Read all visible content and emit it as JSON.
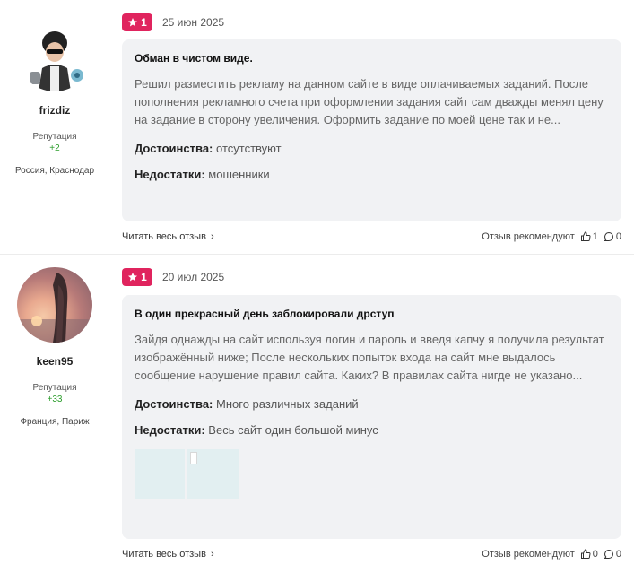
{
  "reviews": [
    {
      "author": {
        "name": "frizdiz",
        "reputation_label": "Репутация",
        "reputation_value": "+2",
        "location": "Россия, Краснодар"
      },
      "rating": "1",
      "date": "25 июн 2025",
      "title": "Обман в чистом виде.",
      "text": "Решил разместить рекламу на данном сайте в виде оплачиваемых заданий. После пополнения рекламного счета при оформлении задания сайт сам дважды менял цену на задание в сторону увеличения. Оформить задание по моей цене так и не...",
      "pros_label": "Достоинства:",
      "pros": "отсутствуют",
      "cons_label": "Недостатки:",
      "cons": "мошенники",
      "read_more": "Читать весь отзыв",
      "recommend_label": "Отзыв рекомендуют",
      "likes": "1",
      "comments": "0"
    },
    {
      "author": {
        "name": "keen95",
        "reputation_label": "Репутация",
        "reputation_value": "+33",
        "location": "Франция, Париж"
      },
      "rating": "1",
      "date": "20 июл 2025",
      "title": "В один прекрасный день заблокировали дрступ",
      "text": "Зайдя однажды на сайт используя логин и пароль и введя капчу я получила результат изображённый ниже; После нескольких попыток входа на сайт мне выдалось сообщение нарушение правил сайта. Каких? В правилах сайта нигде не указано...",
      "pros_label": "Достоинства:",
      "pros": "Много различных заданий",
      "cons_label": "Недостатки:",
      "cons": "Весь сайт один большой минус",
      "read_more": "Читать весь отзыв",
      "recommend_label": "Отзыв рекомендуют",
      "likes": "0",
      "comments": "0"
    }
  ],
  "colors": {
    "badge": "#e0245e",
    "card_bg": "#f1f2f4",
    "reputation": "#2a9d2a"
  },
  "icons": {
    "star": "star-icon",
    "like": "thumbs-up-icon",
    "comment": "comment-icon",
    "chevron": "chevron-right-icon"
  }
}
